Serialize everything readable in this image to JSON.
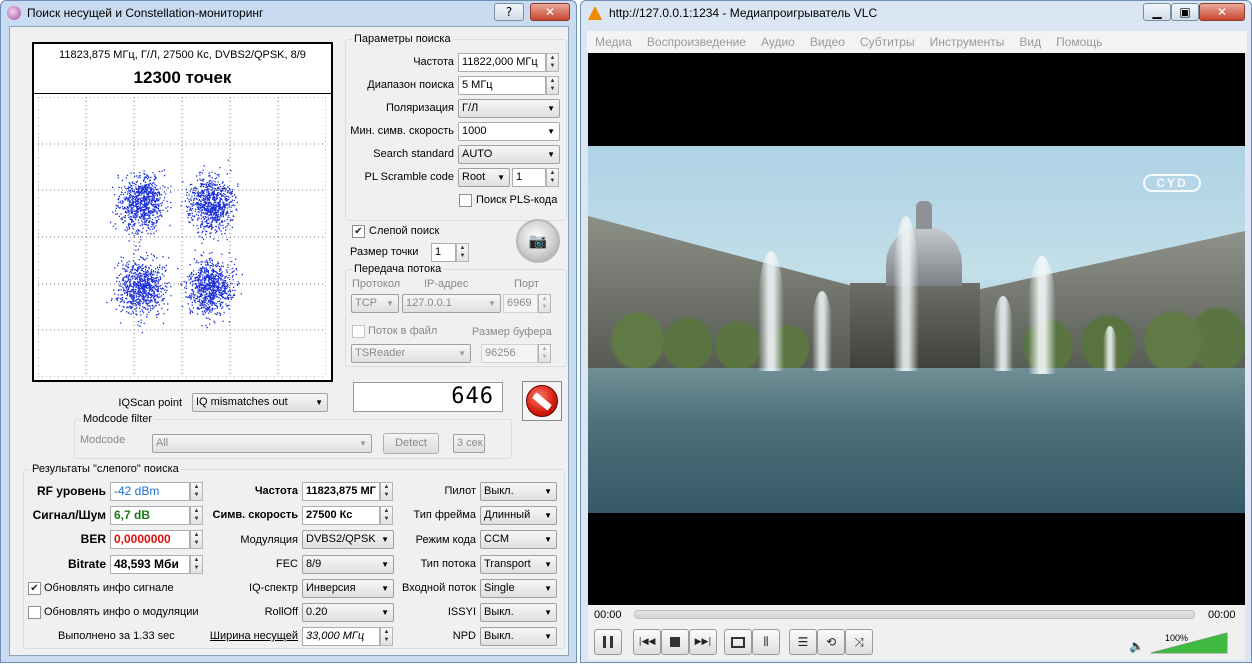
{
  "left_window": {
    "title": "Поиск несущей и Constellation-мониторинг",
    "help_btn": "?",
    "close_btn": "✕",
    "constellation": {
      "header": "11823,875 МГц, Г/Л, 27500 Кс, DVBS2/QPSK, 8/9",
      "points_label": "12300 точек"
    },
    "search_params": {
      "title": "Параметры поиска",
      "freq_label": "Частота",
      "freq_value": "11822,000 МГц",
      "range_label": "Диапазон поиска",
      "range_value": "5 МГц",
      "pol_label": "Поляризация",
      "pol_value": "Г/Л",
      "minsr_label": "Мин. симв. скорость",
      "minsr_value": "1000",
      "std_label": "Search standard",
      "std_value": "AUTO",
      "pl_label": "PL Scramble code",
      "pl_mode": "Root",
      "pl_value": "1",
      "pls_search": "Поиск PLS-кода"
    },
    "blind": {
      "label": "Слепой поиск",
      "point_size_label": "Размер точки",
      "point_size": "1"
    },
    "stream": {
      "title": "Передача потока",
      "proto_label": "Протокол",
      "ip_label": "IP-адрес",
      "port_label": "Порт",
      "proto": "TCP",
      "ip": "127.0.0.1",
      "port": "6969",
      "to_file": "Поток в файл",
      "buffer_label": "Размер буфера",
      "reader": "TSReader",
      "buffer": "96256"
    },
    "counter": "646",
    "iq_label": "IQScan point",
    "iq_value": "IQ mismatches out",
    "modcode": {
      "title": "Modcode filter",
      "label": "Modcode",
      "value": "All",
      "detect": "Detect",
      "time": "3 сек"
    },
    "results": {
      "title": "Результаты \"слепого\" поиска",
      "rf_label": "RF уровень",
      "rf_value": "-42 dBm",
      "snr_label": "Сигнал/Шум",
      "snr_value": "6,7 dB",
      "ber_label": "BER",
      "ber_value": "0,0000000",
      "bitrate_label": "Bitrate",
      "bitrate_value": "48,593 Мби",
      "upd_signal": "Обновлять инфо сигнале",
      "upd_mod": "Обновлять инфо о модуляции",
      "done": "Выполнено за 1.33 sec",
      "freq_label": "Частота",
      "freq_value": "11823,875 МГ",
      "sr_label": "Симв. скорость",
      "sr_value": "27500 Кс",
      "mod_label": "Модуляция",
      "mod_value": "DVBS2/QPSK",
      "fec_label": "FEC",
      "fec_value": "8/9",
      "iqs_label": "IQ-спектр",
      "iqs_value": "Инверсия",
      "rolloff_label": "RollOff",
      "rolloff_value": "0.20",
      "bw_label": "Ширина несущей",
      "bw_value": "33,000 МГц",
      "pilot_label": "Пилот",
      "pilot_value": "Выкл.",
      "frame_label": "Тип фрейма",
      "frame_value": "Длинный",
      "codemode_label": "Режим кода",
      "codemode_value": "CCM",
      "stream_type_label": "Тип потока",
      "stream_type_value": "Transport",
      "input_label": "Входной поток",
      "input_value": "Single",
      "issyi_label": "ISSYI",
      "issyi_value": "Выкл.",
      "npd_label": "NPD",
      "npd_value": "Выкл."
    }
  },
  "vlc": {
    "title": "http://127.0.0.1:1234 - Медиапроигрыватель VLC",
    "menu": [
      "Медиа",
      "Воспроизведение",
      "Аудио",
      "Видео",
      "Субтитры",
      "Инструменты",
      "Вид",
      "Помощь"
    ],
    "time_elapsed": "00:00",
    "time_total": "00:00",
    "volume": "100%",
    "volume_level": 1.0,
    "channel_logo": "CYD",
    "buttons": [
      "pause-icon",
      "prev-icon",
      "stop-icon",
      "next-icon",
      "fullscreen-icon",
      "equalizer-icon",
      "playlist-icon",
      "loop-icon",
      "shuffle-icon"
    ]
  }
}
